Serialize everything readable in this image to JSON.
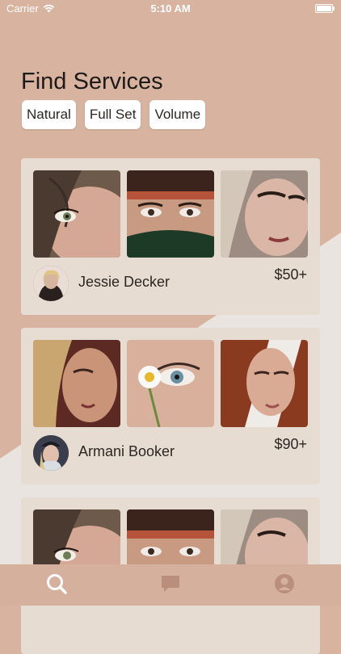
{
  "status_bar": {
    "carrier": "Carrier",
    "time": "5:10 AM",
    "battery_level": 1.0
  },
  "page": {
    "title": "Find Services"
  },
  "filters": [
    {
      "label": "Natural"
    },
    {
      "label": "Full Set"
    },
    {
      "label": "Volume"
    }
  ],
  "providers": [
    {
      "name": "Jessie Decker",
      "price": "$50+"
    },
    {
      "name": "Armani Booker",
      "price": "$90+"
    },
    {
      "name": "",
      "price": ""
    }
  ],
  "tab_bar": {
    "tabs": [
      {
        "icon": "search-icon",
        "active": true
      },
      {
        "icon": "chat-bubble-icon",
        "active": false
      },
      {
        "icon": "profile-icon",
        "active": false
      }
    ]
  },
  "colors": {
    "background": "#d8b4a0",
    "background_light": "#e9e4df",
    "card": "#e7dcd2",
    "tab_active": "#ffffff",
    "tab_inactive": "#b98f7b"
  }
}
